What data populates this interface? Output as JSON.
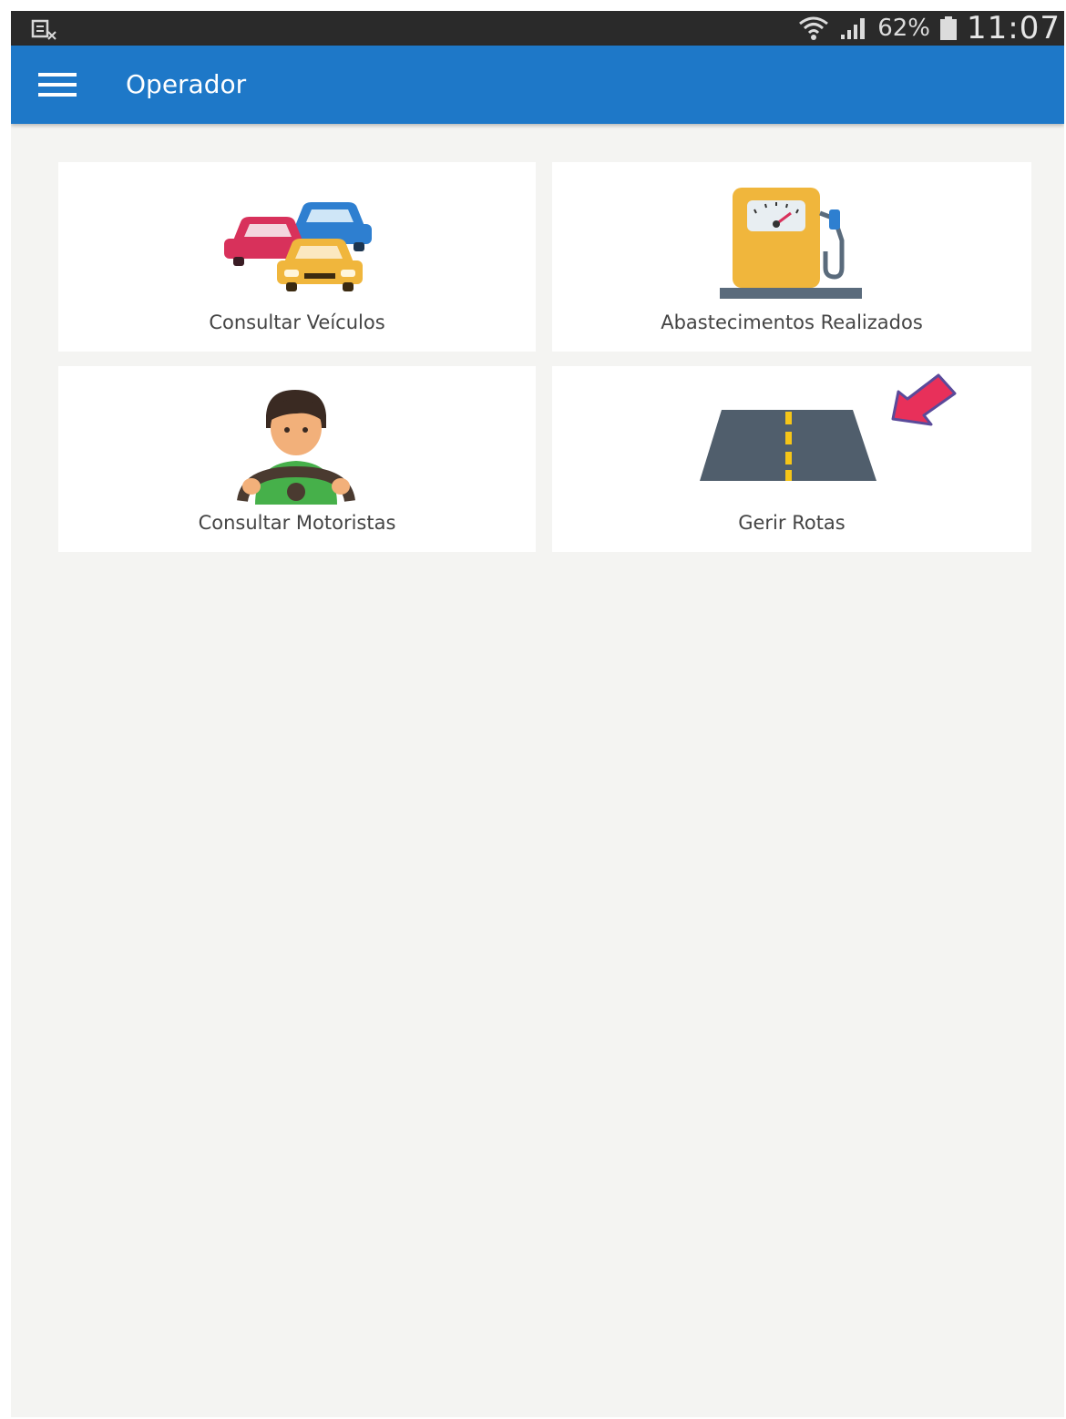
{
  "status_bar": {
    "left_icon": "screenshot-notification-icon",
    "wifi_icon": "wifi-icon",
    "signal_icon": "signal-icon",
    "battery_percent": "62%",
    "battery_icon": "battery-icon",
    "time": "11:07",
    "background": "#2a2a2a"
  },
  "app_bar": {
    "menu_icon": "hamburger-menu-icon",
    "title": "Operador",
    "background": "#1e78c8"
  },
  "tiles": [
    {
      "label": "Consultar Veículos",
      "icon": "cars-icon"
    },
    {
      "label": "Abastecimentos Realizados",
      "icon": "fuel-pump-icon"
    },
    {
      "label": "Consultar Motoristas",
      "icon": "driver-icon"
    },
    {
      "label": "Gerir Rotas",
      "icon": "road-icon"
    }
  ],
  "annotation": {
    "icon": "red-arrow-icon",
    "color": "#e8305a"
  }
}
